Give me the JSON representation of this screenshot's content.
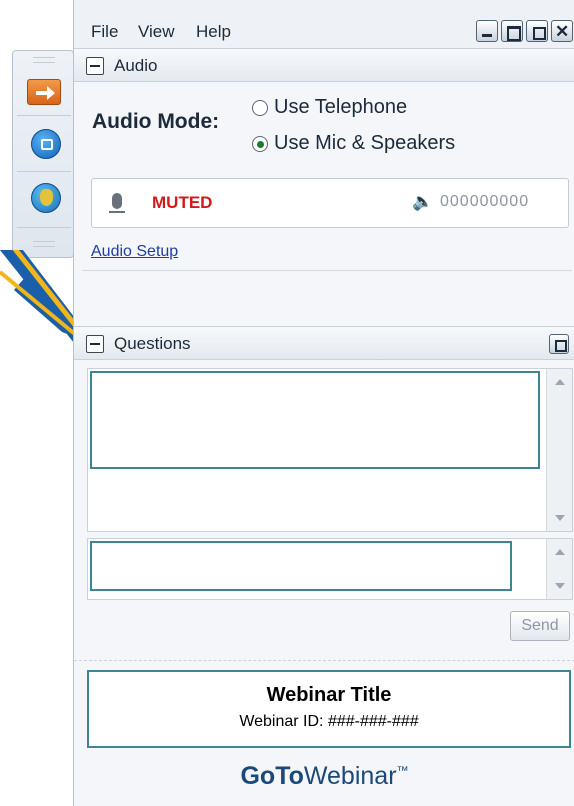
{
  "menu": {
    "file": "File",
    "view": "View",
    "help": "Help"
  },
  "audio": {
    "section_title": "Audio",
    "mode_label": "Audio Mode:",
    "option_telephone": "Use Telephone",
    "option_mic": "Use Mic & Speakers",
    "selected": "Use Mic & Speakers",
    "muted_label": "MUTED",
    "level_digits": "000000000",
    "setup_link": "Audio Setup"
  },
  "questions": {
    "section_title": "Questions",
    "send_label": "Send"
  },
  "webinar": {
    "title": "Webinar Title",
    "id_text": "Webinar ID: ###-###-###"
  },
  "brand": {
    "go": "Go",
    "to": "To",
    "webinar": "Webinar",
    "tm": "™"
  },
  "colors": {
    "muted_red": "#d11a1a",
    "link_blue": "#1f3fa0",
    "highlight_teal": "#3f8590",
    "pointer_yellow": "#f2b51a",
    "pointer_blue": "#1b5fa8"
  },
  "icons": [
    "arrow-right-icon",
    "stop-square-icon",
    "globe-person-icon",
    "microphone-icon",
    "speaker-icon",
    "popout-icon",
    "minimize-icon",
    "maximize-icon",
    "close-icon"
  ]
}
